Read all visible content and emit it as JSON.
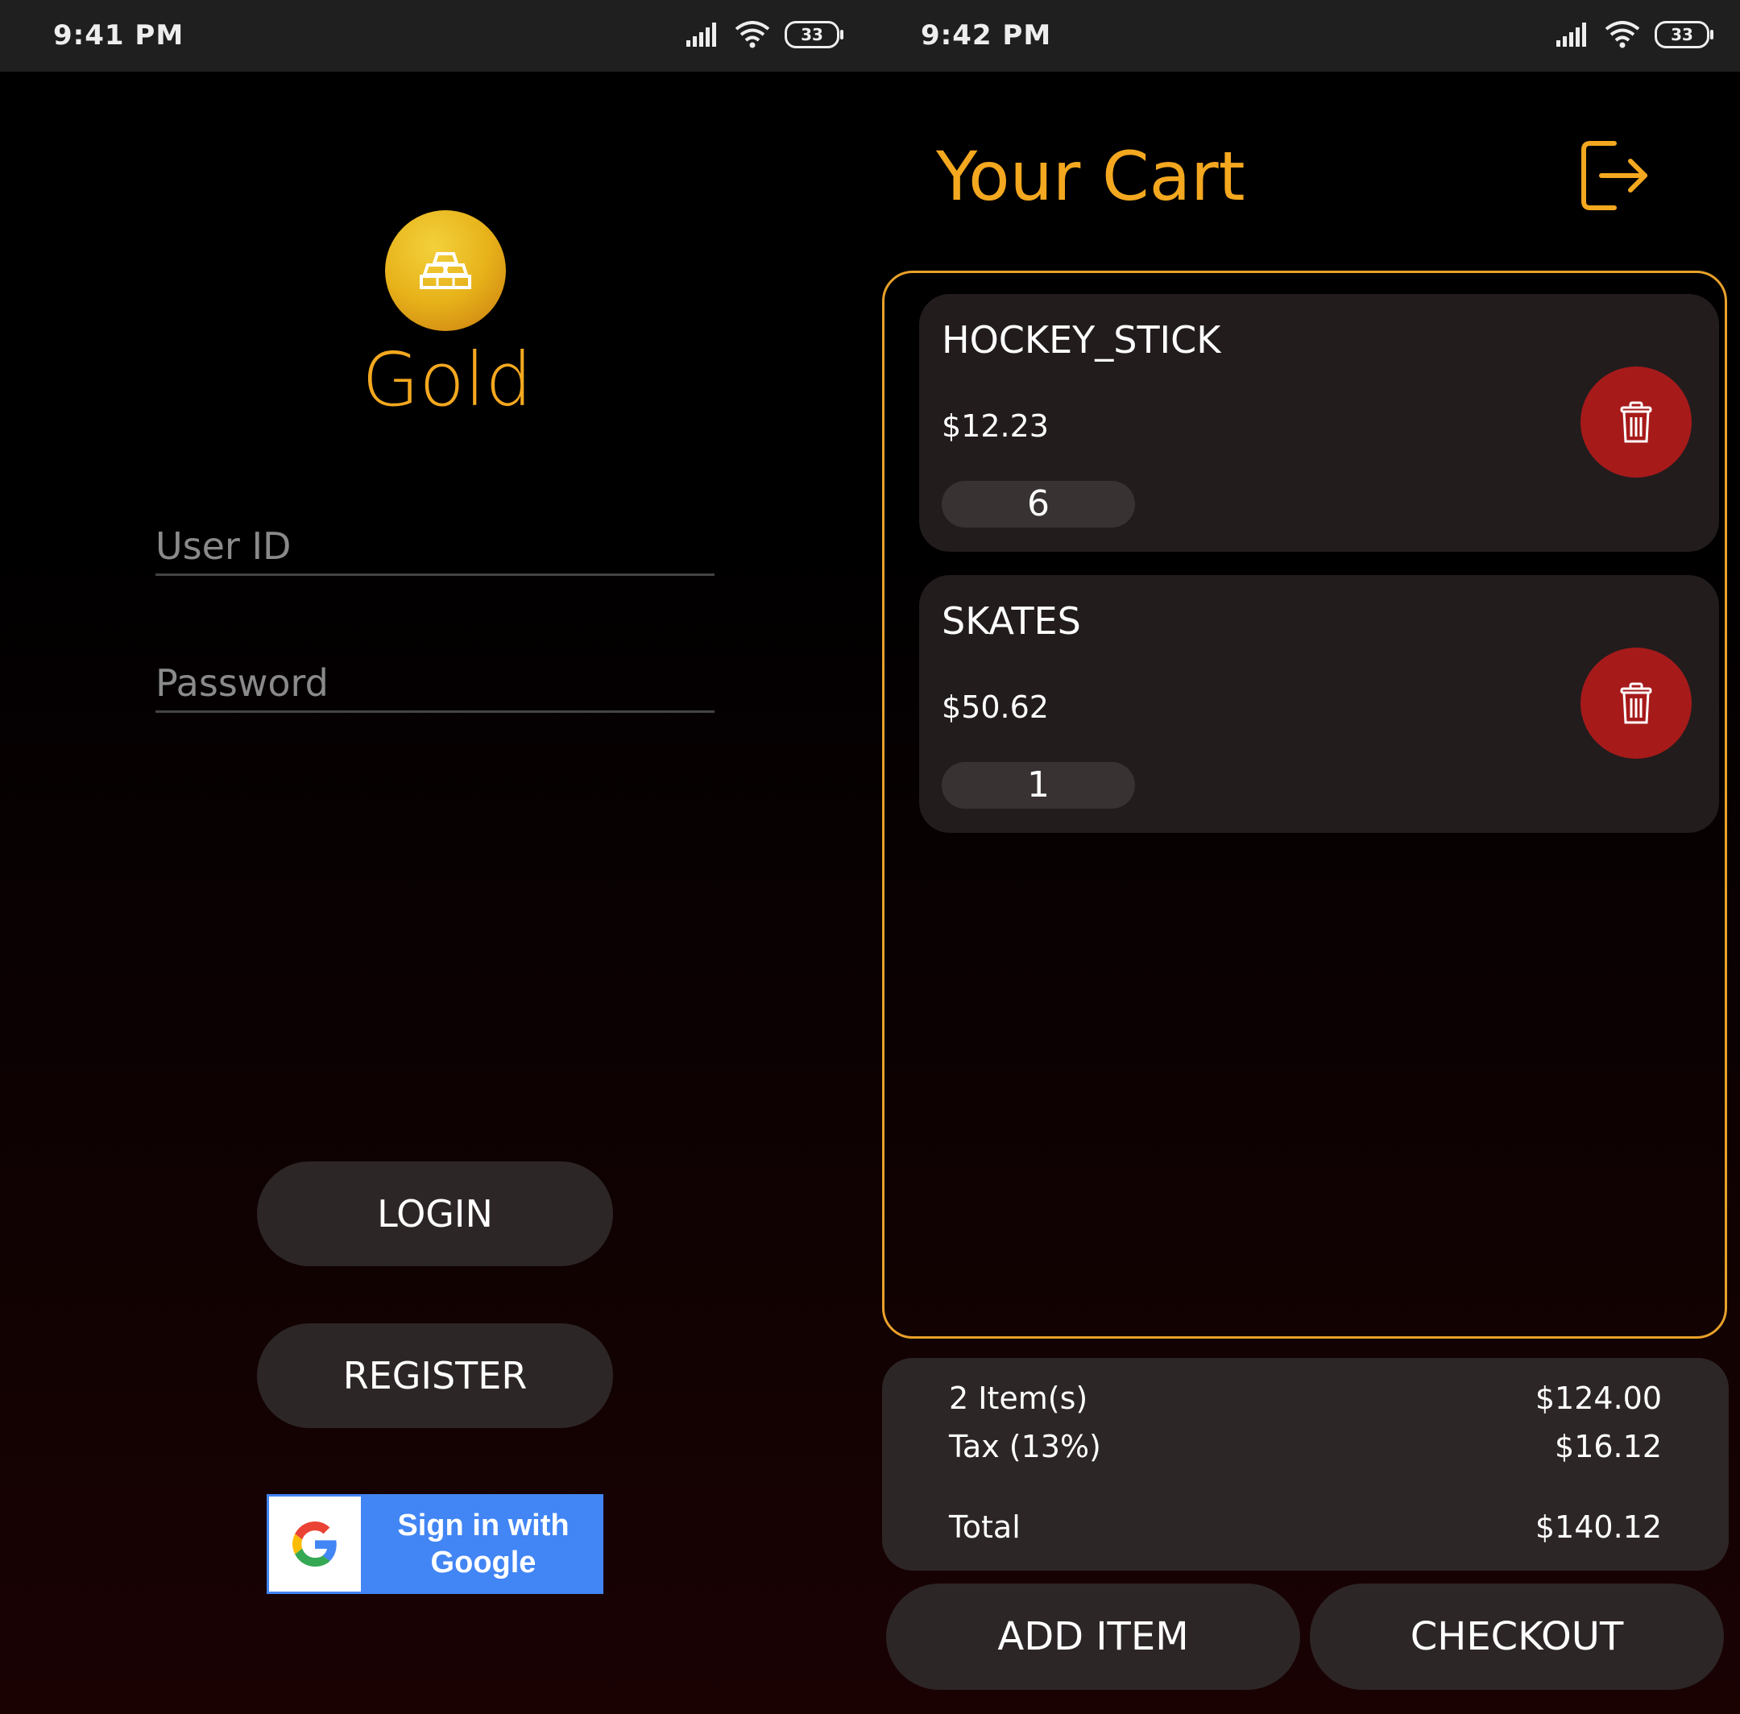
{
  "login_screen": {
    "status_time": "9:41 PM",
    "battery": "33",
    "app_name": "Gold",
    "user_id_placeholder": "User ID",
    "password_placeholder": "Password",
    "login_label": "LOGIN",
    "register_label": "REGISTER",
    "google_label_line1": "Sign in with",
    "google_label_line2": "Google"
  },
  "cart_screen": {
    "status_time": "9:42 PM",
    "battery": "33",
    "title": "Your Cart",
    "items": [
      {
        "name": "HOCKEY_STICK",
        "price": "$12.23",
        "quantity": "6"
      },
      {
        "name": "SKATES",
        "price": "$50.62",
        "quantity": "1"
      }
    ],
    "summary": {
      "items_label": "2 Item(s)",
      "items_value": "$124.00",
      "tax_label": "Tax (13%)",
      "tax_value": "$16.12",
      "total_label": "Total",
      "total_value": "$140.12"
    },
    "add_item_label": "ADD ITEM",
    "checkout_label": "CHECKOUT"
  },
  "colors": {
    "accent_gold": "#f4a81f",
    "delete_red": "#a71a1a",
    "button_bg": "#2d2627",
    "google_blue": "#4285f4"
  },
  "icons": [
    "signal-icon",
    "wifi-icon",
    "battery-icon",
    "gold-bars-icon",
    "google-g-icon",
    "logout-icon",
    "trash-icon"
  ]
}
